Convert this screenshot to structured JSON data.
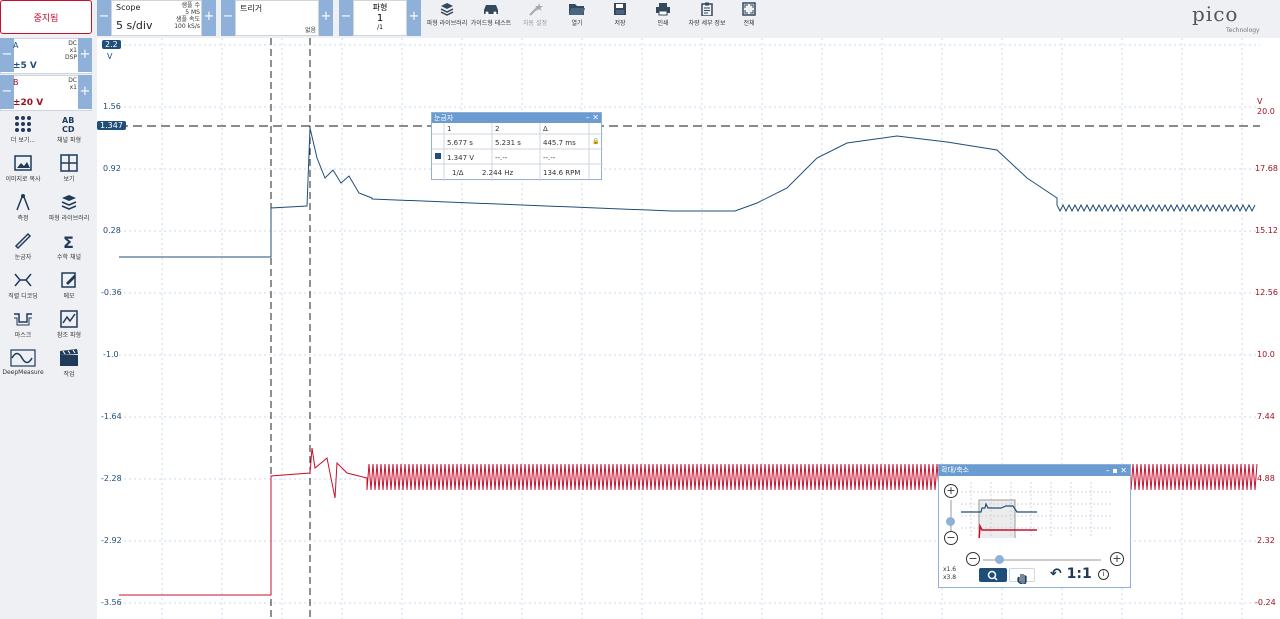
{
  "toolbar": {
    "stop_label": "중지됨",
    "scope": {
      "title": "Scope",
      "timebase": "5 s/div",
      "samples_label": "샘플 수",
      "samples_value": "5 MS",
      "rate_label": "샘플 속도",
      "rate_value": "100 kS/s"
    },
    "trigger": {
      "title": "트리거",
      "mode": "없음"
    },
    "waveform": {
      "title": "파형",
      "index": "1",
      "count": "/1"
    },
    "tools": [
      {
        "label": "파형 라이브러리",
        "icon": "library-icon",
        "enabled": true
      },
      {
        "label": "가이드형 테스트",
        "icon": "car-icon",
        "enabled": true
      },
      {
        "label": "자동 설정",
        "icon": "wand-icon",
        "enabled": false
      },
      {
        "label": "열기",
        "icon": "folder-icon",
        "enabled": true
      },
      {
        "label": "저장",
        "icon": "save-icon",
        "enabled": true
      },
      {
        "label": "인쇄",
        "icon": "printer-icon",
        "enabled": true
      },
      {
        "label": "차량 세부 정보",
        "icon": "clipboard-icon",
        "enabled": true
      },
      {
        "label": "전체",
        "icon": "fullscreen-icon",
        "enabled": true
      }
    ],
    "logo": {
      "brand": "pico",
      "sub": "Technology"
    }
  },
  "channels": [
    {
      "name": "A",
      "coupling": "DC",
      "probe": "x1",
      "dsp": "DSP",
      "range": "±5 V",
      "color": "#1f4e79"
    },
    {
      "name": "B",
      "coupling": "DC",
      "probe": "x1",
      "dsp": "",
      "range": "±20 V",
      "color": "#a01020"
    }
  ],
  "sidebar": [
    {
      "label": "더 보기...",
      "icon": "grid-dots-icon"
    },
    {
      "label": "채널 파형",
      "icon": "abcd-icon"
    },
    {
      "label": "이미지로 복사",
      "icon": "image-icon"
    },
    {
      "label": "보기",
      "icon": "view-grid-icon"
    },
    {
      "label": "측정",
      "icon": "compass-icon"
    },
    {
      "label": "파형 라이브러리",
      "icon": "library-icon"
    },
    {
      "label": "눈금자",
      "icon": "ruler-icon"
    },
    {
      "label": "수학 채널",
      "icon": "sigma-icon"
    },
    {
      "label": "직렬 디코딩",
      "icon": "serial-decode-icon"
    },
    {
      "label": "메모",
      "icon": "note-icon"
    },
    {
      "label": "마스크",
      "icon": "mask-icon"
    },
    {
      "label": "참조 파형",
      "icon": "reference-icon"
    },
    {
      "label": "DeepMeasure",
      "icon": "deepmeasure-icon"
    },
    {
      "label": "작업",
      "icon": "clapper-icon"
    }
  ],
  "axis_left": {
    "unit": "V",
    "top_value": "2.2",
    "ticks": [
      "1.56",
      "0.92",
      "0.28",
      "-0.36",
      "-1.0",
      "-1.64",
      "-2.28",
      "-2.92",
      "-3.56"
    ]
  },
  "axis_right": {
    "unit": "V",
    "ticks": [
      "20.0",
      "17.68",
      "15.12",
      "12.56",
      "10.0",
      "7.44",
      "4.88",
      "2.32",
      "-0.24"
    ]
  },
  "ruler_marker": "1.347",
  "ruler_window": {
    "title": "눈금자",
    "headers": [
      "1",
      "2",
      "Δ"
    ],
    "time_row": [
      "5.677 s",
      "5.231 s",
      "445.7 ms"
    ],
    "volt_row": [
      "1.347 V",
      "--.--",
      "--.--"
    ],
    "freq_row": [
      "1/Δ",
      "2.244 Hz",
      "134.6 RPM"
    ]
  },
  "zoom_window": {
    "title": "확대/축소",
    "zoom_x": "x1.6",
    "zoom_y": "x3.8",
    "reset_label": "1:1"
  },
  "colors": {
    "channel_a": "#1f4e79",
    "channel_b": "#c8102e",
    "accent": "#6a9bd1"
  }
}
